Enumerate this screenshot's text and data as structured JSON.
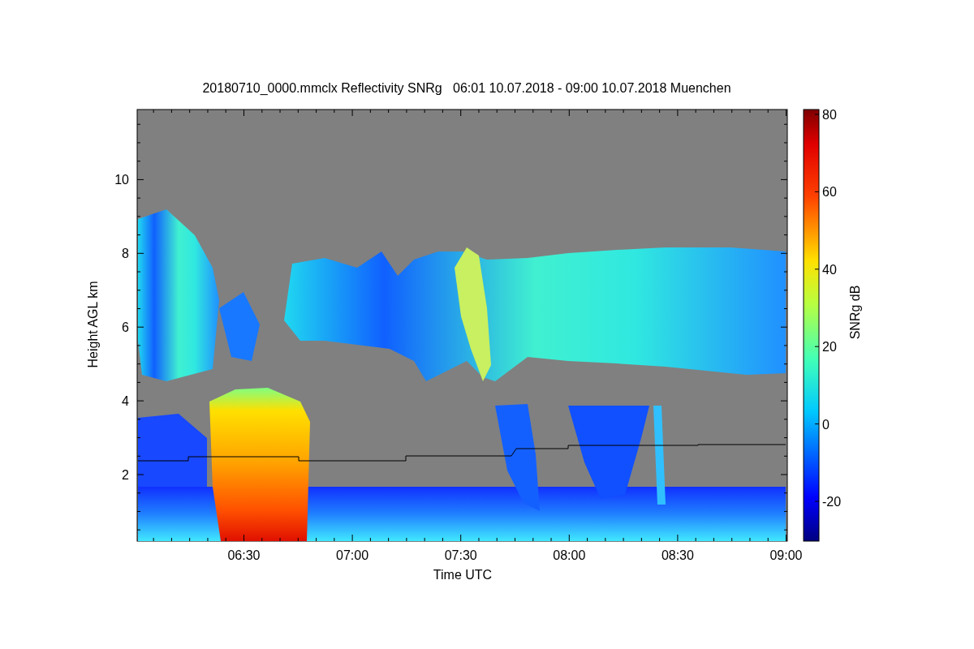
{
  "title": "20180710_0000.mmclx Reflectivity SNRg   06:01 10.07.2018 - 09:00 10.07.2018 Muenchen",
  "plot": {
    "xlabel": "Time UTC",
    "ylabel": "Height AGL km",
    "xticks": [
      "06:30",
      "07:00",
      "07:30",
      "08:00",
      "08:30",
      "09:00"
    ],
    "yticks": [
      "10",
      "8",
      "6",
      "4",
      "2"
    ]
  },
  "colorbar": {
    "label": "SNRg dB",
    "ticks": [
      "80",
      "60",
      "40",
      "20",
      "0",
      "-20"
    ]
  }
}
